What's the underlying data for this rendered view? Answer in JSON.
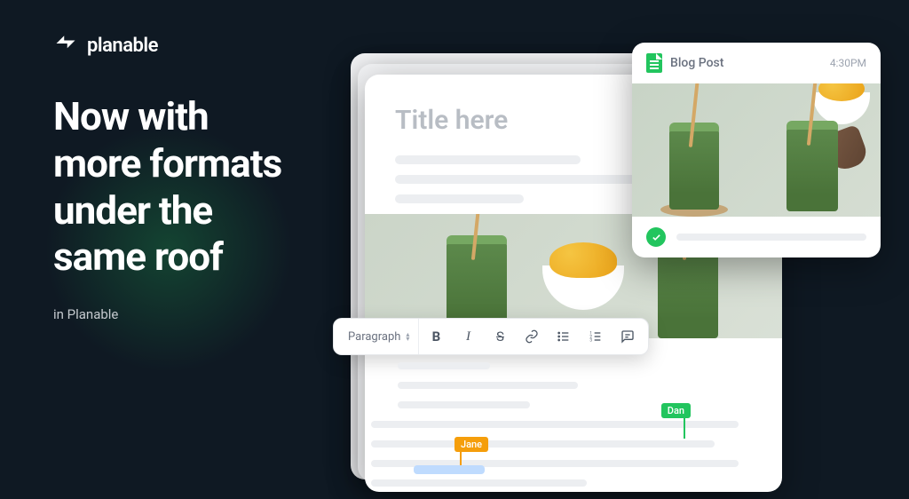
{
  "brand": {
    "name": "planable"
  },
  "hero": {
    "headline": "Now with more formats under the same roof",
    "subline": "in Planable"
  },
  "editor": {
    "title_placeholder": "Title here",
    "toolbar": {
      "style_selector": "Paragraph"
    }
  },
  "collab": {
    "users": {
      "dan": "Dan",
      "jane": "Jane"
    }
  },
  "post_card": {
    "label": "Blog Post",
    "time": "4:30PM"
  }
}
